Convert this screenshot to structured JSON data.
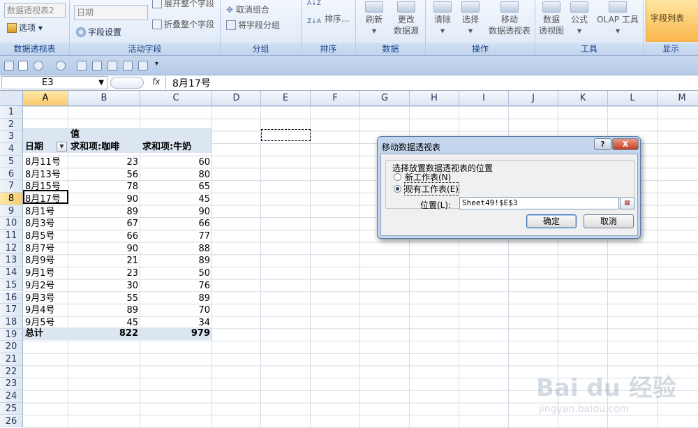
{
  "ribbon": {
    "groups": [
      {
        "label": "数据透视表"
      },
      {
        "label": "活动字段"
      },
      {
        "label": "分组"
      },
      {
        "label": "排序"
      },
      {
        "label": "数据"
      },
      {
        "label": "操作"
      },
      {
        "label": "工具"
      },
      {
        "label": "显示"
      }
    ],
    "pivot_name_value": "数据透视表2",
    "options_label": "选项",
    "field_name_value": "日期",
    "field_settings_label": "字段设置",
    "expand_label": "展开整个字段",
    "collapse_label": "折叠整个字段",
    "ungroup_label": "取消组合",
    "group_field_label": "将字段分组",
    "sort_label": "排序...",
    "refresh_label": "刷新",
    "change_source_label": "更改\n数据源",
    "clear_label": "清除",
    "select_label": "选择",
    "move_label": "移动\n数据透视表",
    "pivot_chart_label": "数据\n透视图",
    "formula_label": "公式",
    "olap_label": "OLAP 工具",
    "field_list_label": "字段列表"
  },
  "formula_bar": {
    "name_box": "E3",
    "fx": "fx",
    "value": "8月17号"
  },
  "columns": [
    "A",
    "B",
    "C",
    "D",
    "E",
    "F",
    "G",
    "H",
    "I",
    "J",
    "K",
    "L",
    "M"
  ],
  "rows": [
    "1",
    "2",
    "3",
    "4",
    "5",
    "6",
    "7",
    "8",
    "9",
    "10",
    "11",
    "12",
    "13",
    "14",
    "15",
    "16",
    "17",
    "18",
    "19",
    "20",
    "21",
    "22",
    "23",
    "24",
    "25",
    "26"
  ],
  "pivot": {
    "values_header": "值",
    "row_label": "日期",
    "col1_label": "求和项:咖啡",
    "col2_label": "求和项:牛奶",
    "rows": [
      {
        "date": "8月11号",
        "coffee": "23",
        "milk": "60"
      },
      {
        "date": "8月13号",
        "coffee": "56",
        "milk": "80"
      },
      {
        "date": "8月15号",
        "coffee": "78",
        "milk": "65"
      },
      {
        "date": "8月17号",
        "coffee": "90",
        "milk": "45"
      },
      {
        "date": "8月1号",
        "coffee": "89",
        "milk": "90"
      },
      {
        "date": "8月3号",
        "coffee": "67",
        "milk": "66"
      },
      {
        "date": "8月5号",
        "coffee": "66",
        "milk": "77"
      },
      {
        "date": "8月7号",
        "coffee": "90",
        "milk": "88"
      },
      {
        "date": "8月9号",
        "coffee": "21",
        "milk": "89"
      },
      {
        "date": "9月1号",
        "coffee": "23",
        "milk": "50"
      },
      {
        "date": "9月2号",
        "coffee": "30",
        "milk": "76"
      },
      {
        "date": "9月3号",
        "coffee": "55",
        "milk": "89"
      },
      {
        "date": "9月4号",
        "coffee": "89",
        "milk": "70"
      },
      {
        "date": "9月5号",
        "coffee": "45",
        "milk": "34"
      }
    ],
    "total_label": "总计",
    "total_coffee": "822",
    "total_milk": "979"
  },
  "dialog": {
    "title": "移动数据透视表",
    "help": "?",
    "close": "X",
    "group_label": "选择放置数据透视表的位置",
    "option_new": "新工作表(N)",
    "option_existing": "现有工作表(E)",
    "location_label": "位置(L):",
    "location_value": "Sheet49!$E$3",
    "ok_label": "确定",
    "cancel_label": "取消"
  },
  "watermark": {
    "brand": "Bai du 经验",
    "url": "jingyan.baidu.com"
  }
}
